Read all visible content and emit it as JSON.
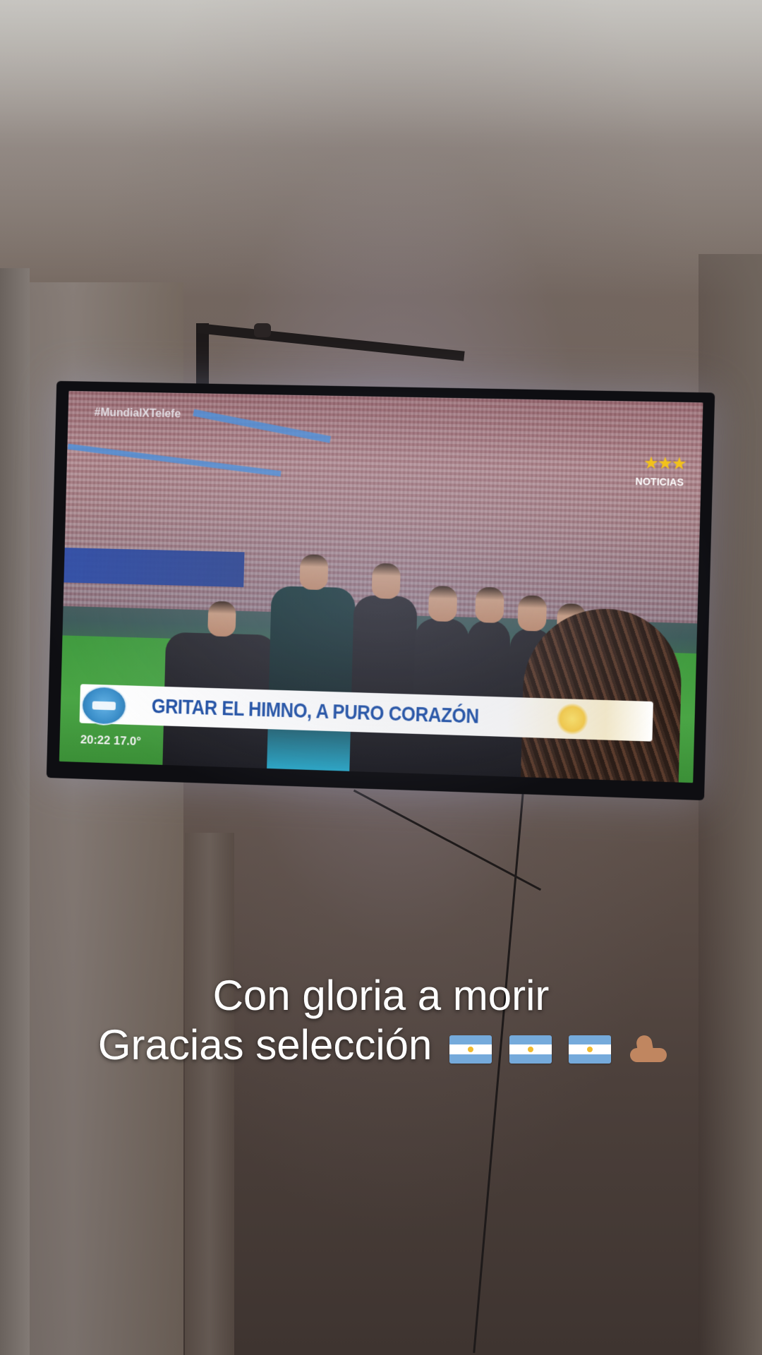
{
  "tv": {
    "hashtag": "#MundialXTelefe",
    "channel_label": "NOTICIAS",
    "stars": "★★★",
    "headline": "GRITAR EL HIMNO, A PURO CORAZÓN",
    "clock": "20:22  17.0°"
  },
  "caption": {
    "line1": "Con gloria a morir",
    "line2": "Gracias selección"
  },
  "emoji": {
    "flags": [
      "argentina-flag",
      "argentina-flag",
      "argentina-flag"
    ],
    "trailing": "flexed-biceps"
  },
  "colors": {
    "headline_blue": "#1f4fa3",
    "star_gold": "#f2c21a",
    "flag_blue": "#75aadb"
  }
}
